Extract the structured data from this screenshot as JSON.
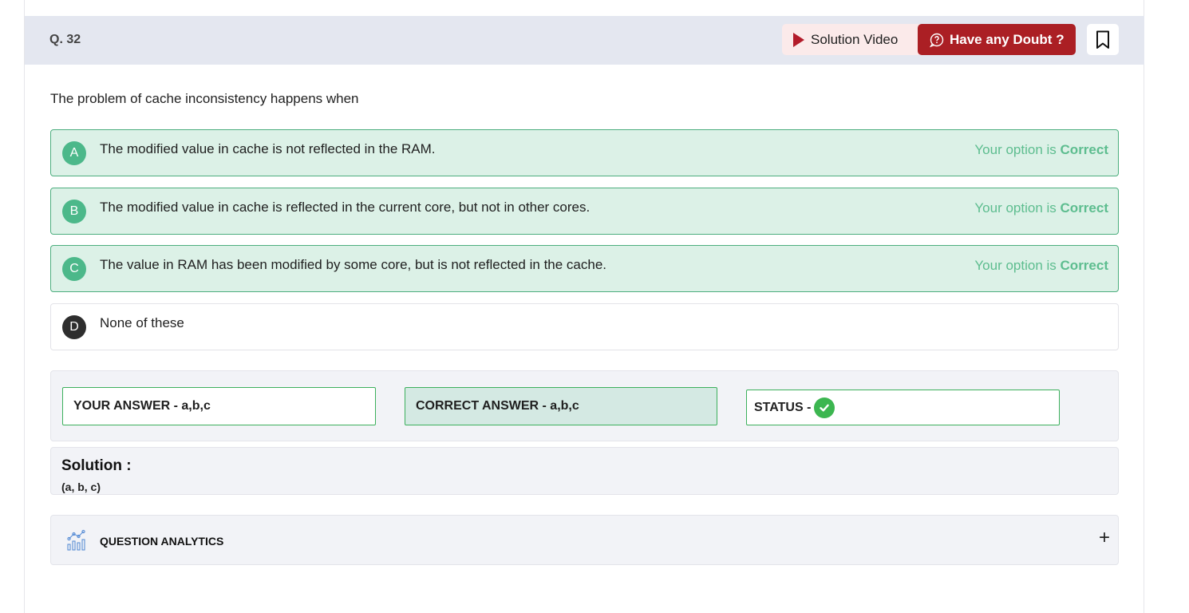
{
  "question": {
    "number": "Q. 32",
    "text": "The problem of cache inconsistency happens when"
  },
  "header": {
    "solution_video_label": "Solution Video",
    "doubt_label": "Have any Doubt ?"
  },
  "options": [
    {
      "letter": "A",
      "text": "The modified value in cache is not reflected in the RAM.",
      "status_prefix": "Your option is ",
      "status_value": "Correct"
    },
    {
      "letter": "B",
      "text": "The modified value in cache is reflected in the current core, but not in other cores.",
      "status_prefix": "Your option is ",
      "status_value": "Correct"
    },
    {
      "letter": "C",
      "text": "The value in RAM has been modified by some core, but is not reflected in the cache.",
      "status_prefix": "Your option is ",
      "status_value": "Correct"
    },
    {
      "letter": "D",
      "text": "None of these"
    }
  ],
  "answers": {
    "your_answer": "YOUR ANSWER - a,b,c",
    "correct_answer": "CORRECT ANSWER - a,b,c",
    "status_label": "STATUS -"
  },
  "solution": {
    "title": "Solution :",
    "text": "(a, b, c)"
  },
  "analytics": {
    "label": "QUESTION ANALYTICS",
    "toggle": "+"
  },
  "colors": {
    "correct_bg": "#dcf1e7",
    "correct_border": "#4cae7e",
    "correct_text": "#5dbd8f",
    "doubt_button": "#ab1f24",
    "status_check": "#3cb650"
  },
  "icons": {
    "solution_video": "play-icon",
    "doubt": "doubt-icon",
    "bookmark": "bookmark-icon",
    "status": "check-circle-icon",
    "analytics": "analytics-chart-icon",
    "toggle": "plus-icon"
  }
}
